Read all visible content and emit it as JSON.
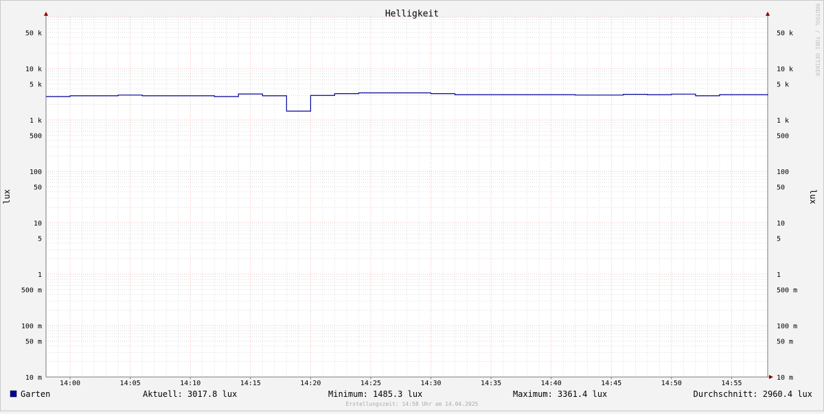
{
  "chart_data": {
    "type": "line",
    "title": "Helligkeit",
    "ylabel": "lux",
    "y_scale": "log",
    "ylim": [
      0.01,
      100000
    ],
    "x_start": "13:58",
    "x_end": "14:58",
    "x_ticks": [
      "14:00",
      "14:05",
      "14:10",
      "14:15",
      "14:20",
      "14:25",
      "14:30",
      "14:35",
      "14:40",
      "14:45",
      "14:50",
      "14:55"
    ],
    "y_ticks": [
      {
        "value": 50000,
        "label": "50 k"
      },
      {
        "value": 10000,
        "label": "10 k"
      },
      {
        "value": 5000,
        "label": "5 k"
      },
      {
        "value": 1000,
        "label": "1 k"
      },
      {
        "value": 500,
        "label": "500"
      },
      {
        "value": 100,
        "label": "100"
      },
      {
        "value": 50,
        "label": "50"
      },
      {
        "value": 10,
        "label": "10"
      },
      {
        "value": 5,
        "label": "5"
      },
      {
        "value": 1,
        "label": "1"
      },
      {
        "value": 0.5,
        "label": "500 m"
      },
      {
        "value": 0.1,
        "label": "100 m"
      },
      {
        "value": 0.05,
        "label": "50 m"
      },
      {
        "value": 0.01,
        "label": "10 m"
      }
    ],
    "grid": true,
    "legend_position": "bottom-left",
    "series": [
      {
        "name": "Garten",
        "color": "#000099",
        "x": [
          "13:58",
          "14:00",
          "14:04",
          "14:06",
          "14:12",
          "14:14",
          "14:16",
          "14:18",
          "14:20",
          "14:22",
          "14:24",
          "14:30",
          "14:32",
          "14:42",
          "14:46",
          "14:48",
          "14:50",
          "14:52",
          "14:54",
          "14:58"
        ],
        "values": [
          2850,
          2950,
          3050,
          2950,
          2850,
          3200,
          2950,
          1485,
          3000,
          3250,
          3361,
          3250,
          3100,
          3050,
          3150,
          3100,
          3180,
          2950,
          3100,
          3018
        ]
      }
    ]
  },
  "legend": {
    "series_name": "Garten",
    "swatch_color": "#000099",
    "aktuell": "Aktuell: 3017.8 lux",
    "minimum": "Minimum: 1485.3 lux",
    "maximum": "Maximum: 3361.4 lux",
    "durchschnitt": "Durchschnitt: 2960.4 lux"
  },
  "footer": "Erstellungszeit: 14:58 Uhr am 14.04.2025",
  "watermark": "RRDTOOL / TOBI OETIKER",
  "colors": {
    "background": "#f3f3f3",
    "plot_area": "#ffffff",
    "major_grid": "#e8a0a0",
    "minor_grid": "#c8c8c8",
    "axis": "#7a7a7a",
    "arrow": "#8b0000"
  }
}
